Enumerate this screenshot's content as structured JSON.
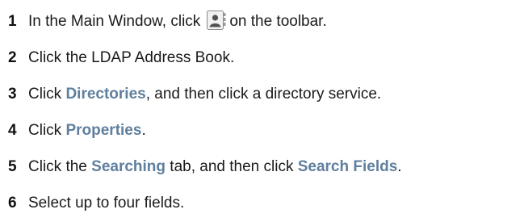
{
  "steps": [
    {
      "num": "1",
      "before": "In the Main Window, click",
      "icon": "address-book-icon",
      "after": "on the toolbar."
    },
    {
      "num": "2",
      "text": "Click the LDAP Address Book."
    },
    {
      "num": "3",
      "pre": "Click",
      "ui": "Directories",
      "post": ", and then click a directory service."
    },
    {
      "num": "4",
      "pre": "Click",
      "ui": "Properties",
      "post": "."
    },
    {
      "num": "5",
      "pre": "Click the",
      "ui": "Searching",
      "mid": "tab, and then click",
      "ui2": "Search Fields",
      "post": "."
    },
    {
      "num": "6",
      "text": "Select up to four fields."
    }
  ],
  "colors": {
    "ui_term": "#5f7f9e",
    "text": "#1a1a1a"
  }
}
